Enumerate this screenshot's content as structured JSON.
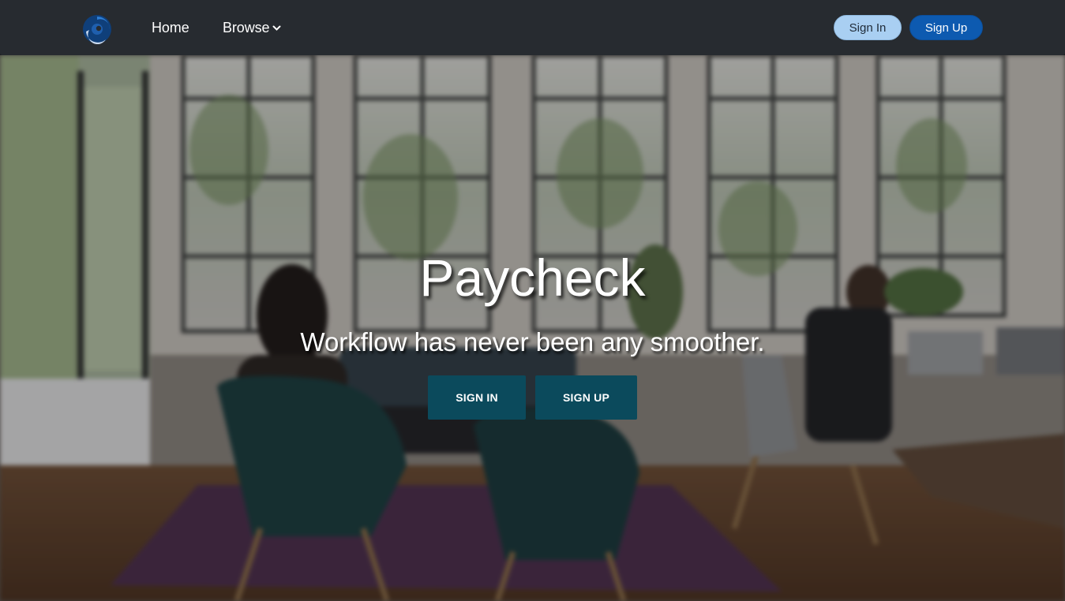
{
  "navbar": {
    "logo_icon": "swirl-logo-icon",
    "home_label": "Home",
    "browse_label": "Browse",
    "browse_icon": "chevron-down-icon",
    "signin_label": "Sign In",
    "signup_label": "Sign Up"
  },
  "hero": {
    "title": "Paycheck",
    "subtitle": "Workflow has never been any smoother.",
    "signin_label": "SIGN IN",
    "signup_label": "SIGN UP",
    "background": "blurred-office-photo"
  },
  "colors": {
    "navbar_bg": "#272b30",
    "signin_pill": "#a9cff2",
    "signup_pill": "#0d5ab0",
    "hero_button": "#0b4a5c"
  }
}
